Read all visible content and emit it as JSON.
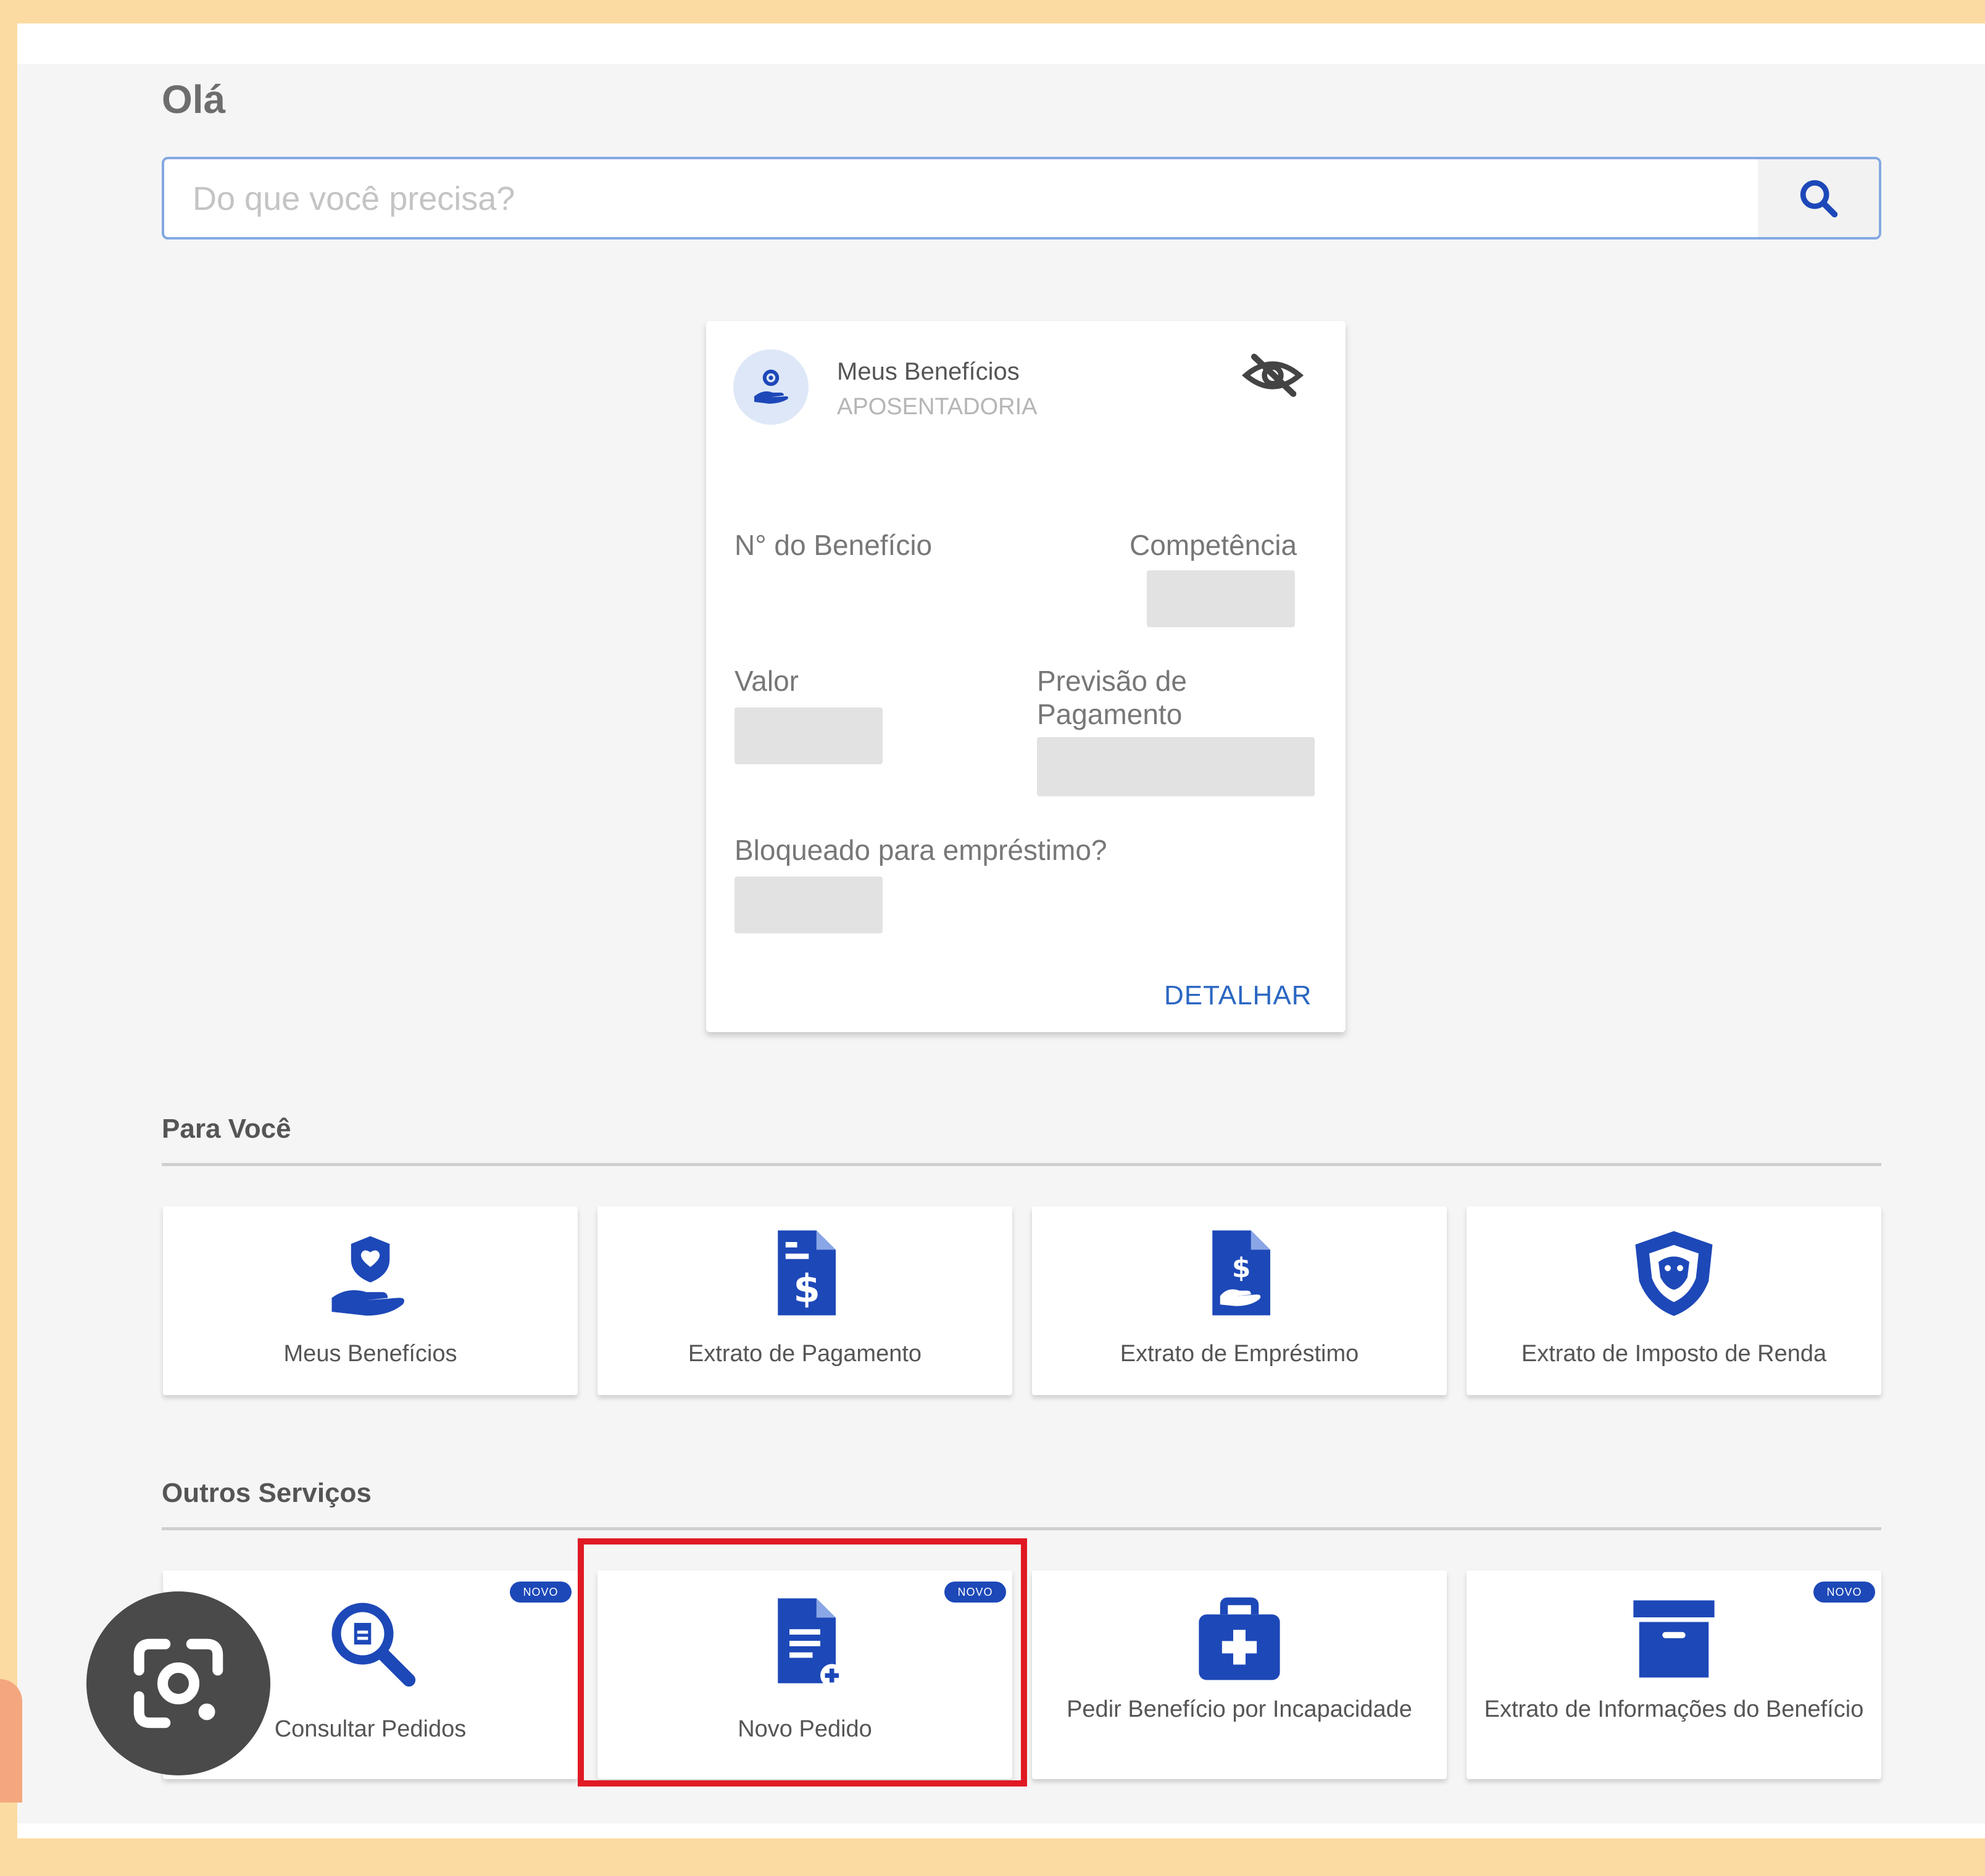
{
  "header": {
    "greeting": "Olá"
  },
  "search": {
    "placeholder": "Do que você precisa?"
  },
  "benefit_card": {
    "title": "Meus Benefícios",
    "subtitle": "APOSENTADORIA",
    "fields": {
      "numero": "N° do Benefício",
      "competencia": "Competência",
      "valor": "Valor",
      "previsao": "Previsão de Pagamento",
      "bloqueado": "Bloqueado para empréstimo?"
    },
    "action": "DETALHAR"
  },
  "sections": {
    "para_voce": {
      "title": "Para Você",
      "items": [
        {
          "label": "Meus Benefícios",
          "icon": "hand-heart-icon"
        },
        {
          "label": "Extrato de Pagamento",
          "icon": "document-dollar-icon"
        },
        {
          "label": "Extrato de Empréstimo",
          "icon": "document-hand-dollar-icon"
        },
        {
          "label": "Extrato de Imposto de Renda",
          "icon": "lion-shield-icon"
        }
      ]
    },
    "outros_servicos": {
      "title": "Outros Serviços",
      "items": [
        {
          "label": "Consultar Pedidos",
          "icon": "search-document-icon",
          "badge": "NOVO"
        },
        {
          "label": "Novo Pedido",
          "icon": "new-document-icon",
          "badge": "NOVO"
        },
        {
          "label": "Pedir Benefício por Incapacidade",
          "icon": "medical-kit-icon"
        },
        {
          "label": "Extrato de Informações do Benefício",
          "icon": "archive-box-icon",
          "badge": "NOVO"
        }
      ]
    }
  },
  "colors": {
    "primary": "#1d48b8",
    "link": "#2b67c2",
    "highlight": "#e01a24",
    "frame": "#fcdba3"
  }
}
